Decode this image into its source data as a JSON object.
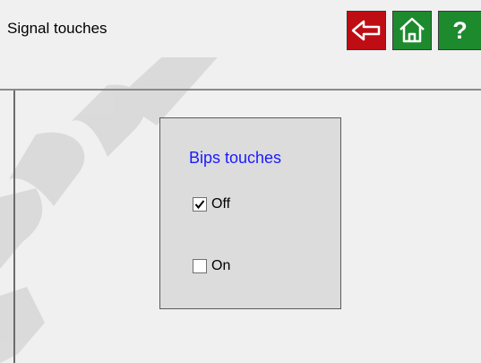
{
  "header": {
    "title": "Signal touches",
    "buttons": {
      "back_icon": "back-arrow-icon",
      "home_icon": "home-icon",
      "help_label": "?"
    },
    "colors": {
      "back_bg": "#bf0d14",
      "home_bg": "#1d8a2e",
      "help_bg": "#1d8a2e"
    }
  },
  "panel": {
    "group_title": "Bips touches",
    "options": [
      {
        "label": "Off",
        "checked": true
      },
      {
        "label": "On",
        "checked": false
      }
    ]
  }
}
